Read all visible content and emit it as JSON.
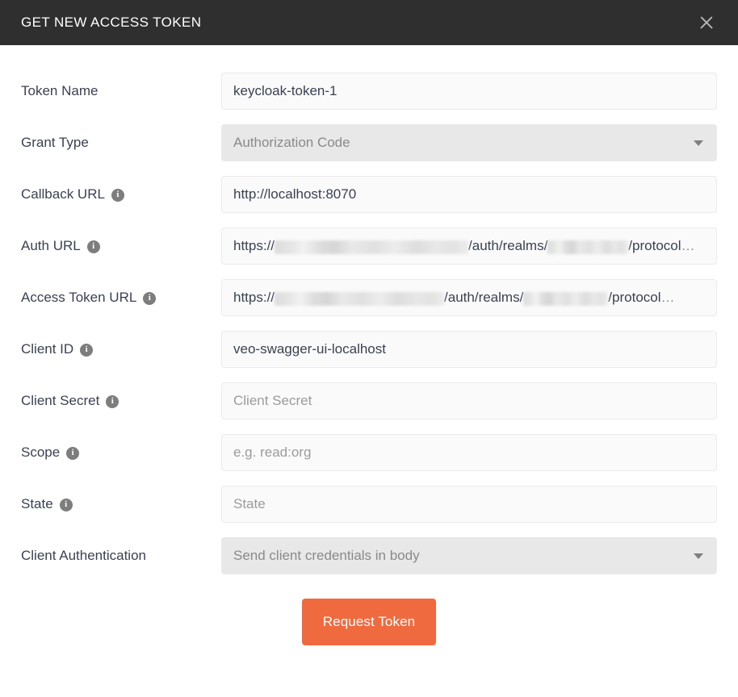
{
  "header": {
    "title": "GET NEW ACCESS TOKEN",
    "close_icon": "close-icon"
  },
  "colors": {
    "header_bg": "#2f2f2f",
    "accent_button": "#f06a3f",
    "input_bg": "#fafafa",
    "select_bg": "#e8e8e8",
    "label_text": "#3b4151",
    "placeholder_text": "#9b9b9b",
    "info_icon": "#7d7d7d"
  },
  "form": {
    "rows": [
      {
        "label": "Token Name",
        "has_info": false,
        "type": "text",
        "value": "keycloak-token-1",
        "placeholder": "Token Name"
      },
      {
        "label": "Grant Type",
        "has_info": false,
        "type": "select",
        "value": "Authorization Code"
      },
      {
        "label": "Callback URL",
        "has_info": true,
        "type": "text",
        "value": "http://localhost:8070",
        "placeholder": "Callback URL"
      },
      {
        "label": "Auth URL",
        "has_info": true,
        "type": "masked-url",
        "prefix": "https://",
        "middle": "/auth/realms/",
        "suffix": "/protocol",
        "ellipsis": "…"
      },
      {
        "label": "Access Token URL",
        "has_info": true,
        "type": "masked-url",
        "prefix": "https://",
        "middle": "/auth/realms/",
        "suffix": "/protocol",
        "ellipsis": "…"
      },
      {
        "label": "Client ID",
        "has_info": true,
        "type": "text",
        "value": "veo-swagger-ui-localhost",
        "placeholder": "Client ID"
      },
      {
        "label": "Client Secret",
        "has_info": true,
        "type": "text",
        "value": "",
        "placeholder": "Client Secret"
      },
      {
        "label": "Scope",
        "has_info": true,
        "type": "text",
        "value": "",
        "placeholder": "e.g. read:org"
      },
      {
        "label": "State",
        "has_info": true,
        "type": "text",
        "value": "",
        "placeholder": "State"
      },
      {
        "label": "Client Authentication",
        "has_info": false,
        "type": "select",
        "value": "Send client credentials in body"
      }
    ],
    "info_glyph": "i",
    "caret_icon": "chevron-down-icon"
  },
  "footer": {
    "request_button": "Request Token"
  }
}
